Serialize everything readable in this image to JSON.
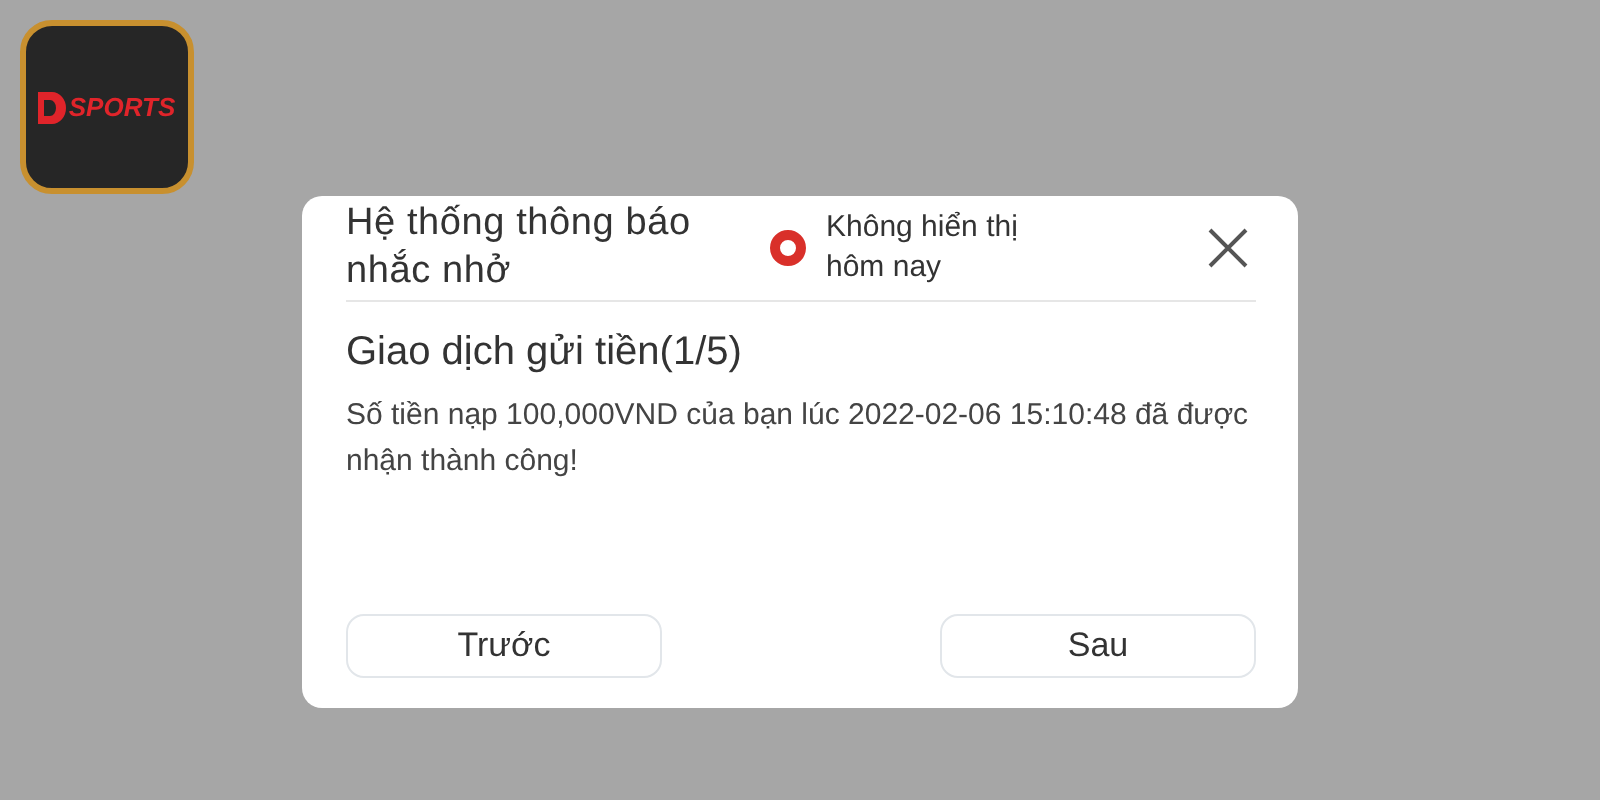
{
  "logo": {
    "text": "SPORTS"
  },
  "dialog": {
    "title": "Hệ thống thông báo nhắc nhở",
    "hide_today": {
      "label": "Không hiển thị hôm nay",
      "checked": true
    },
    "heading": "Giao dịch gửi tiền(1/5)",
    "message": "Số tiền nạp 100,000VND của bạn lúc 2022-02-06 15:10:48 đã được nhận thành công!",
    "buttons": [
      {
        "label": "Trước"
      },
      {
        "label": "Sau"
      }
    ]
  }
}
